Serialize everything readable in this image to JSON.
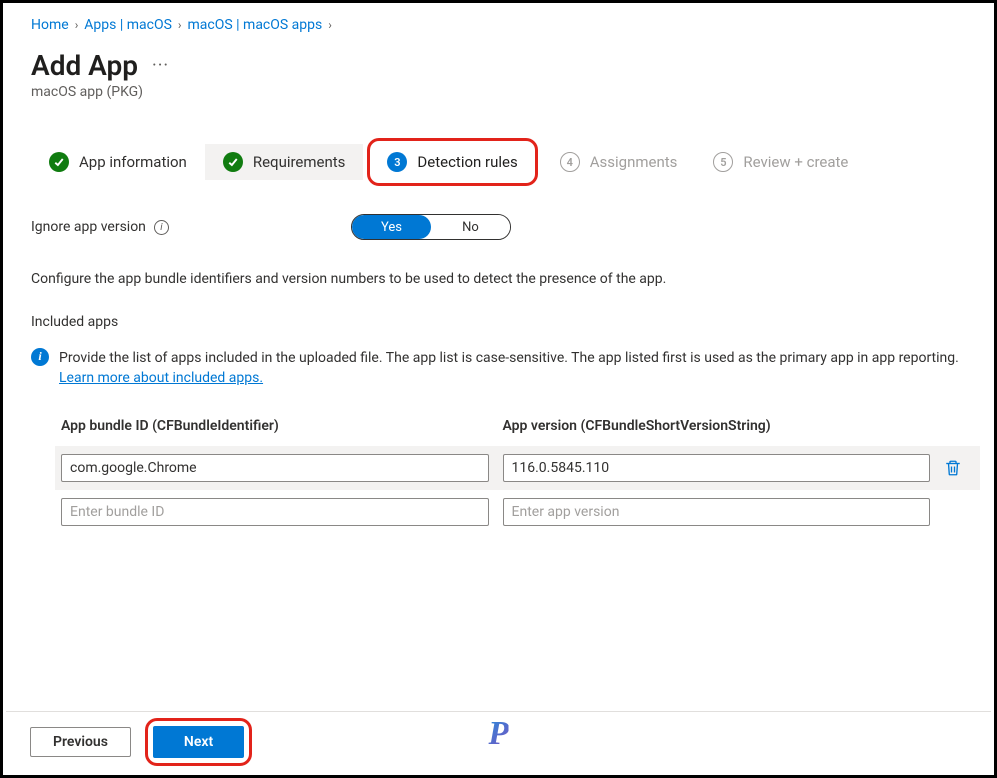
{
  "breadcrumb": {
    "items": [
      {
        "label": "Home"
      },
      {
        "label": "Apps | macOS"
      },
      {
        "label": "macOS | macOS apps"
      }
    ]
  },
  "header": {
    "title": "Add App",
    "more": "···",
    "subtitle": "macOS app (PKG)"
  },
  "wizard": {
    "steps": [
      {
        "label": "App information",
        "state": "done"
      },
      {
        "label": "Requirements",
        "state": "done"
      },
      {
        "label": "Detection rules",
        "state": "active",
        "num": "3"
      },
      {
        "label": "Assignments",
        "state": "upcoming",
        "num": "4"
      },
      {
        "label": "Review + create",
        "state": "upcoming",
        "num": "5"
      }
    ]
  },
  "form": {
    "ignore_label": "Ignore app version",
    "toggle": {
      "yes": "Yes",
      "no": "No",
      "value": "Yes"
    },
    "configure_text": "Configure the app bundle identifiers and version numbers to be used to detect the presence of the app.",
    "included_head": "Included apps",
    "info_text": "Provide the list of apps included in the uploaded file. The app list is case-sensitive. The app listed first is used as the primary app in app reporting. ",
    "info_link": "Learn more about included apps."
  },
  "table": {
    "col1": "App bundle ID (CFBundleIdentifier)",
    "col2": "App version (CFBundleShortVersionString)",
    "rows": [
      {
        "bundle": "com.google.Chrome",
        "version": "116.0.5845.110"
      },
      {
        "bundle": "",
        "version": ""
      }
    ],
    "ph_bundle": "Enter bundle ID",
    "ph_version": "Enter app version"
  },
  "footer": {
    "previous": "Previous",
    "next": "Next"
  }
}
